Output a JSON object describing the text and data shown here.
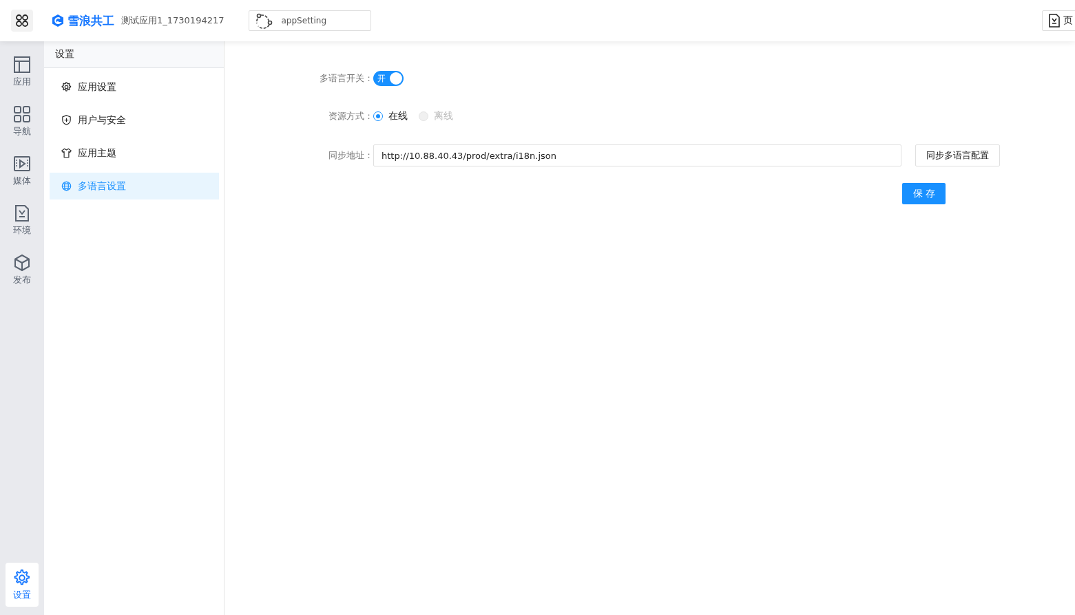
{
  "header": {
    "brand": "雪浪共工",
    "app_name": "测试应用1_1730194217",
    "page_selector": "appSetting",
    "right_button": "页"
  },
  "rail": [
    {
      "label": "应用",
      "selected": false
    },
    {
      "label": "导航",
      "selected": false
    },
    {
      "label": "媒体",
      "selected": false
    },
    {
      "label": "环境",
      "selected": false
    },
    {
      "label": "发布",
      "selected": false
    }
  ],
  "rail_bottom": {
    "label": "设置",
    "selected": true
  },
  "sidebar": {
    "title": "设置",
    "items": [
      {
        "label": "应用设置",
        "selected": false
      },
      {
        "label": "用户与安全",
        "selected": false
      },
      {
        "label": "应用主题",
        "selected": false
      },
      {
        "label": "多语言设置",
        "selected": true
      }
    ]
  },
  "form": {
    "switch": {
      "label": "多语言开关：",
      "text": "开",
      "on": true
    },
    "source": {
      "label": "资源方式：",
      "options": [
        {
          "label": "在线",
          "selected": true,
          "disabled": false
        },
        {
          "label": "离线",
          "selected": false,
          "disabled": true
        }
      ]
    },
    "sync": {
      "label": "同步地址：",
      "value": "http://10.88.40.43/prod/extra/i18n.json",
      "button": "同步多语言配置"
    },
    "save": "保存"
  }
}
